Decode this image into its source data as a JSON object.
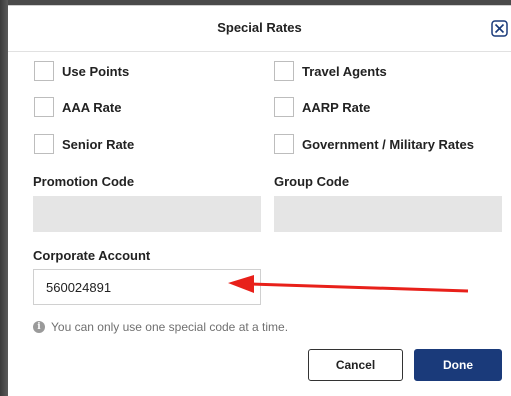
{
  "modal": {
    "title": "Special Rates"
  },
  "checkboxes": {
    "left": [
      {
        "label": "Use Points"
      },
      {
        "label": "AAA Rate"
      },
      {
        "label": "Senior Rate"
      }
    ],
    "right": [
      {
        "label": "Travel Agents"
      },
      {
        "label": "AARP Rate"
      },
      {
        "label": "Government / Military Rates"
      }
    ]
  },
  "fields": {
    "promotion_code": {
      "label": "Promotion Code",
      "value": ""
    },
    "group_code": {
      "label": "Group Code",
      "value": ""
    },
    "corporate_account": {
      "label": "Corporate Account",
      "value": "560024891"
    }
  },
  "info": {
    "icon": "info-icon",
    "text": "You can only use one special code at a time."
  },
  "buttons": {
    "cancel": "Cancel",
    "done": "Done"
  },
  "annotation": {
    "arrow_color": "#e8201a"
  },
  "colors": {
    "primary": "#1a3a7a",
    "disabled_field": "#e5e5e5"
  }
}
